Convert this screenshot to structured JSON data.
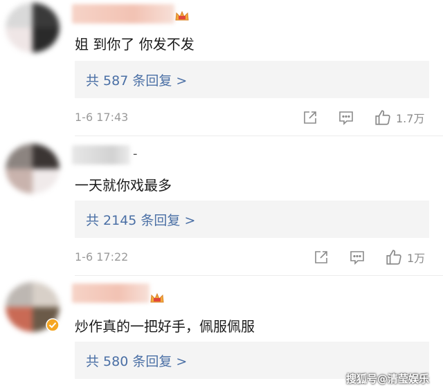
{
  "comments": [
    {
      "text": "姐 到你了 你发不发",
      "reply_link": "共 587 条回复 >",
      "time": "1-6 17:43",
      "like_count": "1.7万",
      "username_badge": "vip-crown-icon"
    },
    {
      "text": "一天就你戏最多",
      "username_suffix": "-",
      "reply_link": "共 2145 条回复 >",
      "time": "1-6 17:22",
      "like_count": "1万"
    },
    {
      "text": "炒作真的一把好手，佩服佩服",
      "reply_link": "共 580 条回复 >",
      "username_badge": "vip-crown-icon",
      "avatar_badge": "verified-icon"
    }
  ],
  "watermark": "搜狐号@清莹娱乐",
  "colors": {
    "link": "#4a6fa5",
    "meta": "#9a9a9a",
    "reply_bg": "#f4f4f4",
    "verified": "#f5a623"
  },
  "icons": {
    "share": "share-icon",
    "comment": "comment-icon",
    "like": "thumbs-up-icon"
  }
}
